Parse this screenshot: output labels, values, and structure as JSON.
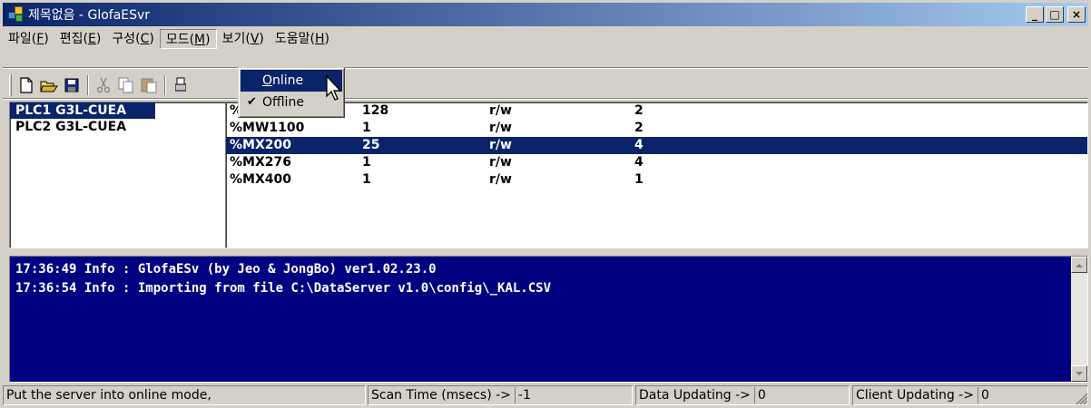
{
  "window": {
    "title": "제목없음 - GlofaESvr",
    "buttons": {
      "minimize": "_",
      "maximize": "□",
      "close": "×"
    }
  },
  "menubar": [
    {
      "label": "파일(",
      "key": "F",
      "suffix": ")"
    },
    {
      "label": "편집(",
      "key": "E",
      "suffix": ")"
    },
    {
      "label": "구성(",
      "key": "C",
      "suffix": ")"
    },
    {
      "label": "모드(",
      "key": "M",
      "suffix": ")"
    },
    {
      "label": "보기(",
      "key": "V",
      "suffix": ")"
    },
    {
      "label": "도움말(",
      "key": "H",
      "suffix": ")"
    }
  ],
  "toolbar": {
    "icons": [
      "new-file-icon",
      "open-folder-icon",
      "save-icon",
      "cut-icon",
      "copy-icon",
      "paste-icon",
      "print-icon"
    ]
  },
  "mode_menu": {
    "items": [
      {
        "label_key": "O",
        "label_rest": "nline",
        "checked": false
      },
      {
        "label_key": "",
        "label_rest": "Offline",
        "checked": true,
        "check_glyph": "✔"
      }
    ]
  },
  "plc_list": [
    "PLC1 G3L-CUEA",
    "PLC2 G3L-CUEA"
  ],
  "tags": [
    {
      "address": "%",
      "value": "128",
      "access": "r/w",
      "count": "2"
    },
    {
      "address": "%MW1100",
      "value": "1",
      "access": "r/w",
      "count": "2"
    },
    {
      "address": "%MX200",
      "value": "25",
      "access": "r/w",
      "count": "4"
    },
    {
      "address": "%MX276",
      "value": "1",
      "access": "r/w",
      "count": "4"
    },
    {
      "address": "%MX400",
      "value": "1",
      "access": "r/w",
      "count": "1"
    }
  ],
  "log": [
    "17:36:49 Info : GlofaESv (by Jeo & JongBo) ver1.02.23.0",
    "17:36:54 Info : Importing from file C:\\DataServer v1.0\\config\\_KAL.CSV"
  ],
  "statusbar": {
    "message": "Put the server into online mode,",
    "scan_label": "Scan Time (msecs) ->",
    "scan_value": "-1",
    "data_label": "Data Updating ->",
    "data_value": "0",
    "client_label": "Client Updating ->",
    "client_value": "0"
  },
  "colors": {
    "title_start": "#0a246a",
    "title_end": "#a6caf0",
    "selection": "#0a246a",
    "log_bg": "#000080",
    "face": "#d4d0c8"
  }
}
